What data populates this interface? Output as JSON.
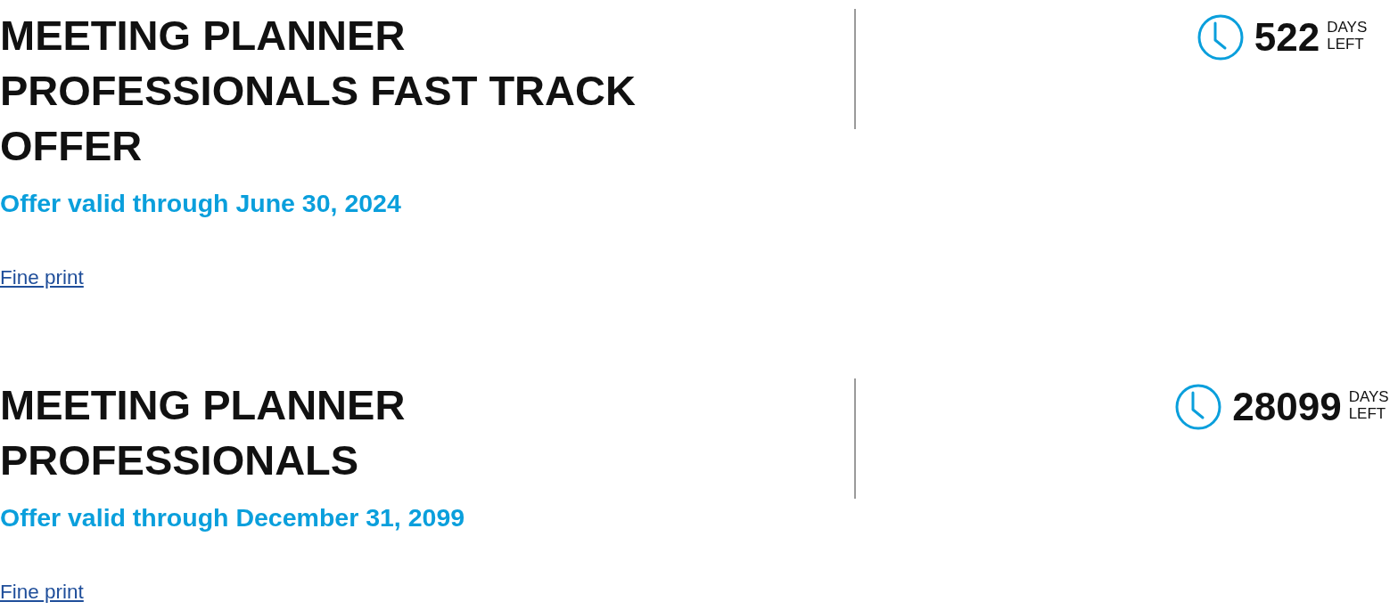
{
  "offers": [
    {
      "title": "MEETING PLANNER PROFESSIONALS FAST TRACK OFFER",
      "validity": "Offer valid through June 30, 2024",
      "link": "Fine print",
      "countdown": {
        "days": "522",
        "unit": "DAYS LEFT"
      }
    },
    {
      "title": "MEETING PLANNER PROFESSIONALS",
      "validity": "Offer valid through December 31, 2099",
      "link": "Fine print",
      "countdown": {
        "days": "28099",
        "unit": "DAYS LEFT"
      }
    }
  ]
}
